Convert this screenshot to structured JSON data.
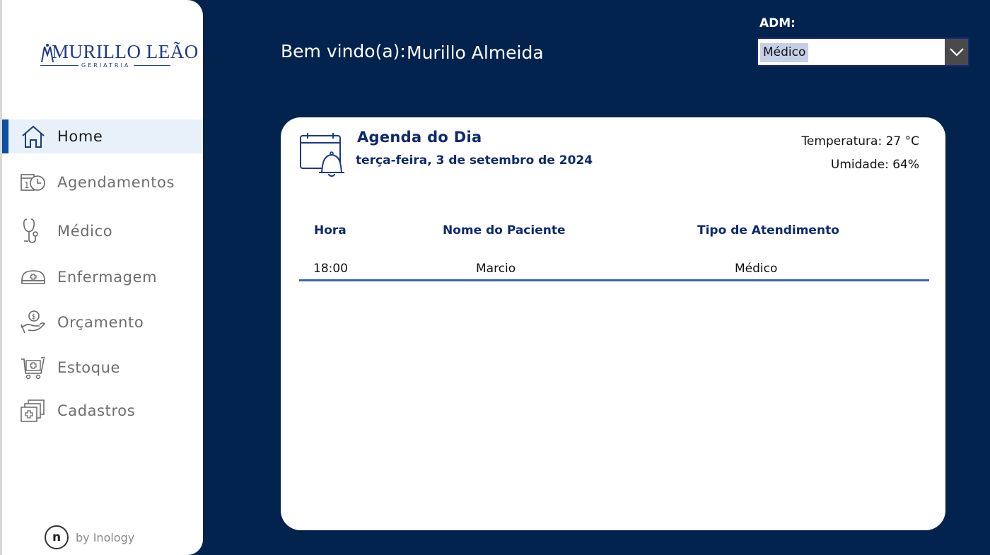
{
  "brand": {
    "logo_main": "MURILLO LEÃO",
    "logo_sub": "GERIATRIA",
    "footer_text": "by Inology",
    "footer_logo_letter": "n"
  },
  "sidebar": {
    "items": [
      {
        "label": "Home",
        "icon": "home-icon",
        "active": true
      },
      {
        "label": "Agendamentos",
        "icon": "calendar-clock-icon"
      },
      {
        "label": "Médico",
        "icon": "stethoscope-icon"
      },
      {
        "label": "Enfermagem",
        "icon": "nurse-cap-icon"
      },
      {
        "label": "Orçamento",
        "icon": "money-hand-icon"
      },
      {
        "label": "Estoque",
        "icon": "medical-cart-icon"
      },
      {
        "label": "Cadastros",
        "icon": "medical-files-icon"
      }
    ]
  },
  "header": {
    "welcome_label": "Bem vindo(a):",
    "user_name": "Murillo Almeida",
    "adm_label": "ADM:",
    "role_selected": "Médico"
  },
  "agenda": {
    "title": "Agenda do Dia",
    "date": "terça-feira, 3 de setembro de 2024",
    "temperature": "Temperatura: 27 °C",
    "humidity": "Umidade: 64%",
    "columns": [
      "Hora",
      "Nome do Paciente",
      "Tipo de Atendimento"
    ],
    "rows": [
      {
        "hora": "18:00",
        "paciente": "Marcio",
        "tipo": "Médico"
      }
    ]
  },
  "colors": {
    "background": "#03234f",
    "accent": "#0b4ea2",
    "title": "#0d2a6e"
  }
}
